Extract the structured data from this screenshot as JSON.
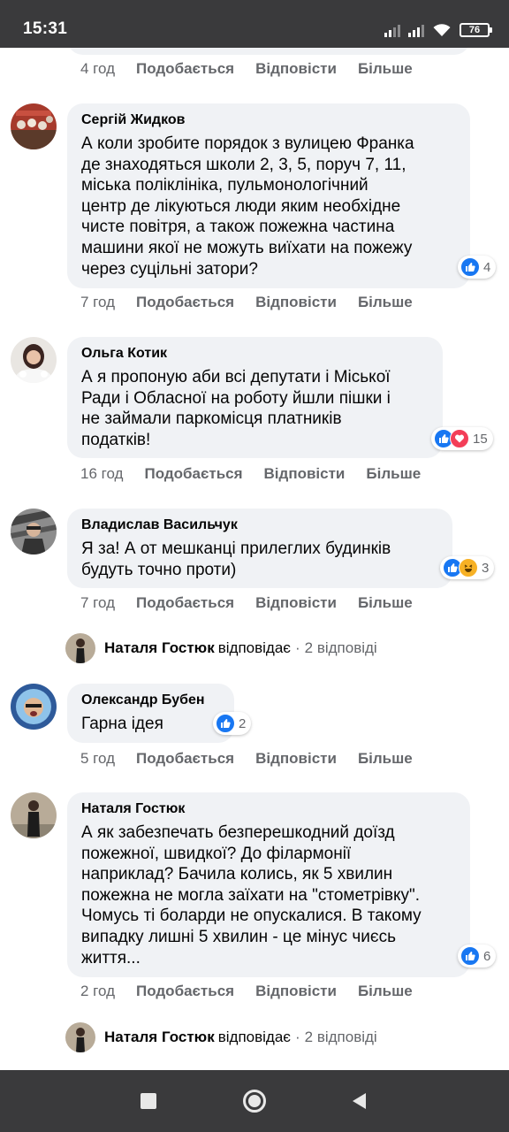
{
  "status": {
    "time": "15:31",
    "battery": "76"
  },
  "labels": {
    "like": "Подобається",
    "reply": "Відповісти",
    "more": "Більше"
  },
  "previous": {
    "time": "4 год"
  },
  "comments": [
    {
      "author": "Сергій Жидков",
      "text": "А коли зробите порядок з вулицею Франка\nде знаходяться школи 2, 3, 5, поруч 7, 11,\nміська поліклініка, пульмонологічний\nцентр де лікуються люди яким необхідне\nчисте повітря, а також пожежна частина\nмашини якої не можуть виїхати на пожежу\nчерез суцільні затори?",
      "time": "7 год",
      "reactions": [
        "like"
      ],
      "reaction_count": "4"
    },
    {
      "author": "Ольга Котик",
      "text": "А я пропоную аби всі депутати і Міської\nРади і Обласної на роботу йшли пішки і\nне займали паркомісця платників\nподатків!",
      "time": "16 год",
      "reactions": [
        "like",
        "love"
      ],
      "reaction_count": "15"
    },
    {
      "author": "Владислав Васильчук",
      "text": "Я за! А от мешканці прилеглих будинків\nбудуть точно проти)",
      "time": "7 год",
      "reactions": [
        "like",
        "haha"
      ],
      "reaction_count": "3",
      "reply_summary": {
        "name": "Наталя Гостюк",
        "verb": "відповідає",
        "count": "2 відповіді"
      }
    },
    {
      "author": "Олександр Бубен",
      "text": "Гарна ідея",
      "time": "5 год",
      "reactions": [
        "like"
      ],
      "reaction_count": "2"
    },
    {
      "author": "Наталя Гостюк",
      "text": "А як забезпечать безперешкодний доїзд\nпожежної, швидкої? До філармонії\nнаприклад? Бачила колись, як 5 хвилин\nпожежна не могла заїхати на \"стометрівку\".\nЧомусь ті боларди не опускалися. В такому\nвипадку лишні 5 хвилин - це мінус чиєсь\nжиття...",
      "time": "2 год",
      "reactions": [
        "like"
      ],
      "reaction_count": "6",
      "reply_summary": {
        "name": "Наталя Гостюк",
        "verb": "відповідає",
        "count": "2 відповіді"
      }
    }
  ],
  "colors": {
    "bubble": "#f0f2f5",
    "meta": "#65676b",
    "like": "#1877f2",
    "love": "#f33e58",
    "haha": "#f7b125",
    "system_bar": "#3a3a3c"
  }
}
